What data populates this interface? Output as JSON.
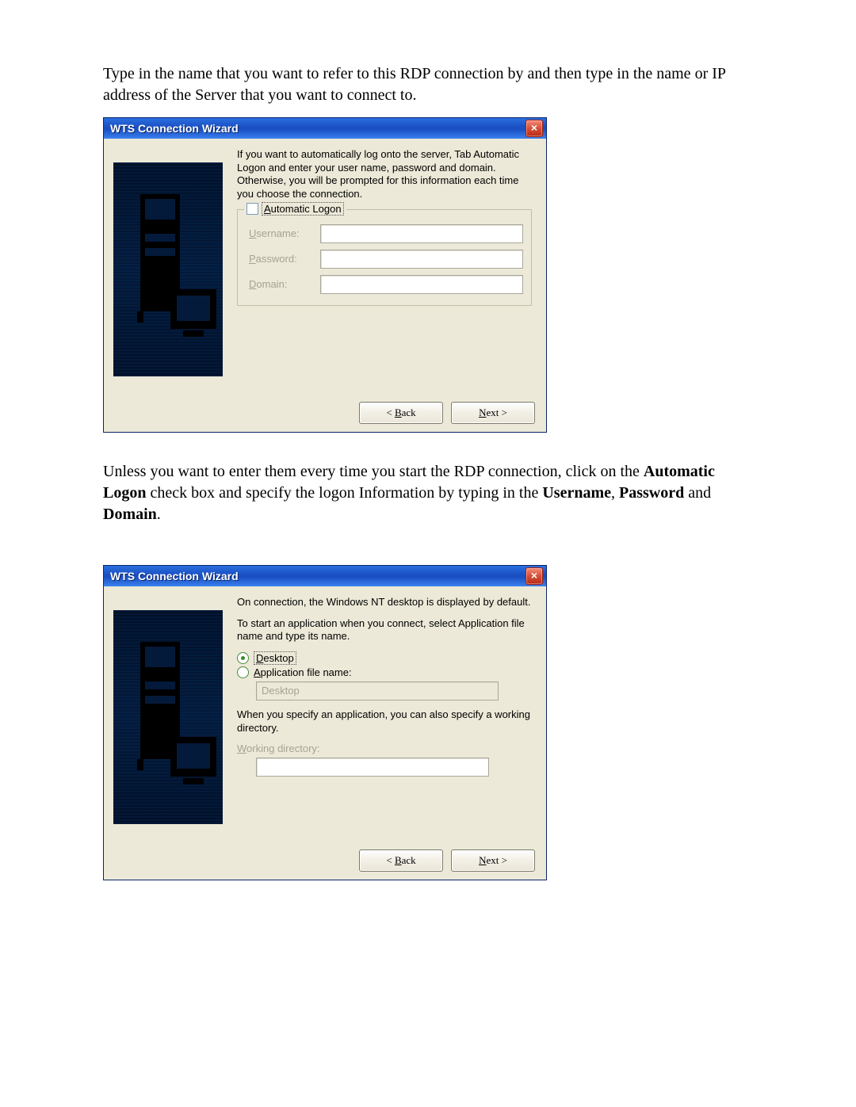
{
  "intro1": "Type in the name that you want to refer to this RDP connection by and then type in the name or IP address of the Server that you want to connect to.",
  "middle": {
    "p1_pre": "Unless you want to enter them every time you start the RDP connection, click on the ",
    "b1": "Automatic Logon",
    "p1_mid": " check box and specify the logon Information by typing in the ",
    "b2": "Username",
    "comma": ", ",
    "b3": "Password",
    "and": " and ",
    "b4": "Domain",
    "period": "."
  },
  "dlg1": {
    "title": "WTS Connection Wizard",
    "desc": "If you want to automatically log onto the server, Tab Automatic Logon and enter your user name, password and domain. Otherwise, you will be prompted for this information each time you choose the connection.",
    "autologon": "Automatic Logon",
    "username": "Username:",
    "password": "Password:",
    "domain": "Domain:",
    "back": "Back",
    "next": "Next"
  },
  "dlg2": {
    "title": "WTS Connection Wizard",
    "desc1": "On connection, the Windows NT desktop is displayed by default.",
    "desc2": "To start an application when you connect, select Application file name and type its name.",
    "optDesktop": "Desktop",
    "optApp": "Application file name:",
    "appValue": "Desktop",
    "whenSpec": "When you specify an application, you can also specify a working directory.",
    "wdLabel": "Working directory:",
    "back": "Back",
    "next": "Next"
  }
}
